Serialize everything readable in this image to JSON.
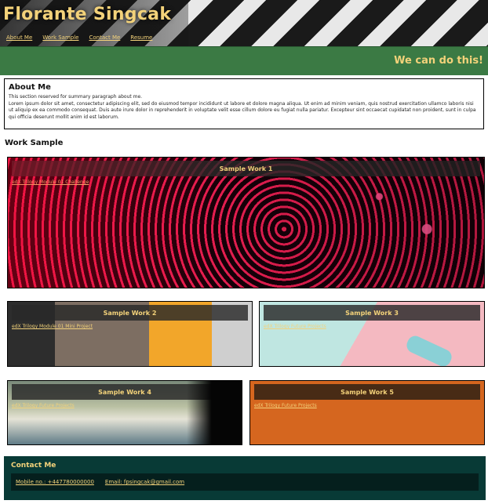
{
  "header": {
    "site_title": "Florante Singcak",
    "nav": [
      "About Me",
      "Work Sample",
      "Contact Me",
      "Resume"
    ],
    "tagline": "We can do this!"
  },
  "about": {
    "heading": "About Me",
    "intro": "This section reserved for summary paragraph about me.",
    "body": "Lorem ipsum dolor sit amet, consectetur adipiscing elit, sed do eiusmod tempor incididunt ut labore et dolore magna aliqua. Ut enim ad minim veniam, quis nostrud exercitation ullamco laboris nisi ut aliquip ex ea commodo consequat. Duis aute irure dolor in reprehenderit in voluptate velit esse cillum dolore eu fugiat nulla pariatur. Excepteur sint occaecat cupidatat non proident, sunt in culpa qui officia deserunt mollit anim id est laborum."
  },
  "work": {
    "heading": "Work Sample",
    "items": [
      {
        "title": "Sample Work 1",
        "link": "edX Trilogy Module 01 Challenge"
      },
      {
        "title": "Sample Work 2",
        "link": "edX Trilogy Module 01 Mini Project"
      },
      {
        "title": "Sample Work 3",
        "link": "edX Trilogy Future Projects"
      },
      {
        "title": "Sample Work 4",
        "link": "edX Trilogy Future Projects"
      },
      {
        "title": "Sample Work 5",
        "link": "edX Trilogy Future Projects"
      }
    ]
  },
  "contact": {
    "heading": "Contact Me",
    "mobile": "Mobile no.: +447780000000",
    "email": "Email: fpsingcak@gmail.com"
  },
  "colors": {
    "accent": "#f3d27a",
    "banner": "#3b7a44",
    "contact_bg": "#083a36",
    "card5_bg": "#d5661f"
  }
}
